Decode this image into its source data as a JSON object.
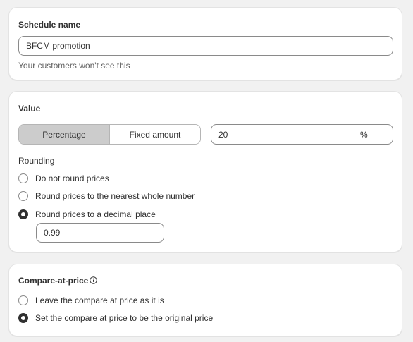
{
  "schedule": {
    "title": "Schedule name",
    "value": "BFCM promotion",
    "help": "Your customers won't see this"
  },
  "value_section": {
    "title": "Value",
    "segments": [
      "Percentage",
      "Fixed amount"
    ],
    "selected_segment": "Percentage",
    "amount": "20",
    "suffix": "%",
    "rounding_label": "Rounding",
    "rounding_options": [
      "Do not round prices",
      "Round prices to the nearest whole number",
      "Round prices to a decimal place"
    ],
    "selected_rounding": "Round prices to a decimal place",
    "decimal_value": "0.99"
  },
  "compare": {
    "title": "Compare-at-price",
    "options": [
      "Leave the compare at price as it is",
      "Set the compare at price to be the original price"
    ],
    "selected": "Set the compare at price to be the original price"
  },
  "colors": {
    "background": "#f1f1f1",
    "card": "#ffffff",
    "segment_active": "#cccccc",
    "text": "#303030"
  }
}
